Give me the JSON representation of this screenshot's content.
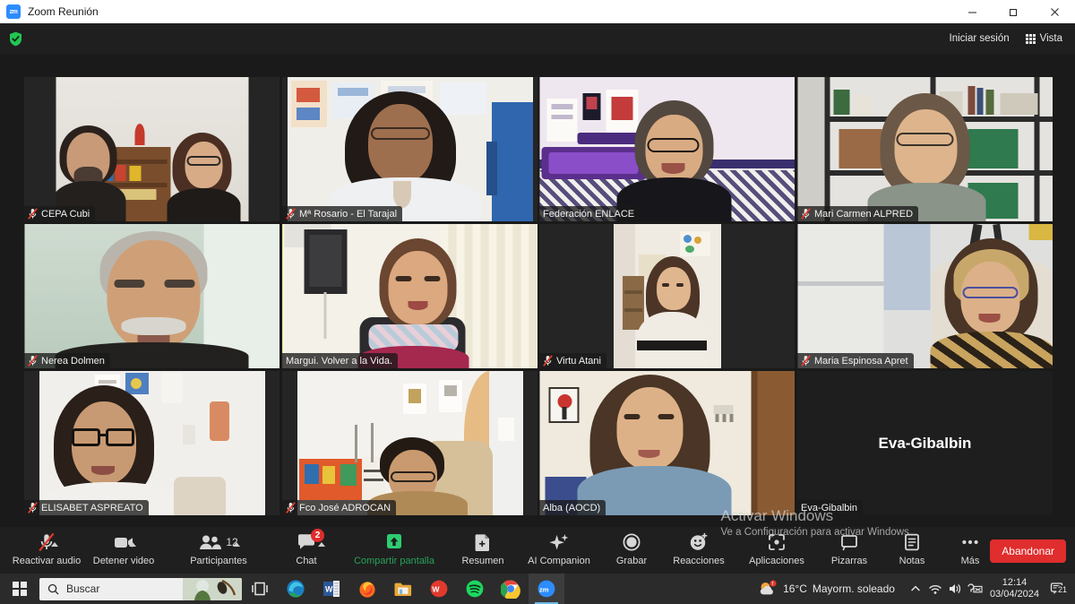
{
  "window": {
    "app_icon": "zoom-logo-icon",
    "title": "Zoom Reunión",
    "minimize": "–",
    "maximize": "□",
    "close": "✕"
  },
  "zoom_header": {
    "security_icon": "green-shield-check-icon",
    "sign_in_label": "Iniciar sesión",
    "view_label": "Vista",
    "view_icon": "grid-view-icon"
  },
  "participants_grid": {
    "rows": 3,
    "columns": 4,
    "tiles": [
      {
        "name": "CEPA Cubi",
        "muted": true,
        "camera_on": true,
        "active_speaker": false,
        "scene": "two-people-shelf"
      },
      {
        "name": "Mª Rosario - El Tarajal",
        "muted": true,
        "camera_on": true,
        "active_speaker": false,
        "scene": "woman-glasses-classroom"
      },
      {
        "name": "Federación ENLACE",
        "muted": false,
        "camera_on": true,
        "active_speaker": false,
        "scene": "woman-glasses-purple-wall"
      },
      {
        "name": "Mari Carmen ALPRED",
        "muted": true,
        "camera_on": true,
        "active_speaker": false,
        "scene": "woman-office-shelves"
      },
      {
        "name": "Nerea Dolmen",
        "muted": true,
        "camera_on": true,
        "active_speaker": false,
        "scene": "man-beard-green-wall"
      },
      {
        "name": "Margui. Volver a la Vida.",
        "muted": false,
        "camera_on": true,
        "active_speaker": true,
        "scene": "woman-scarf-speaker"
      },
      {
        "name": "Virtu Atani",
        "muted": true,
        "camera_on": true,
        "active_speaker": false,
        "scene": "woman-white-sweater-room"
      },
      {
        "name": "Maria Espinosa Apret",
        "muted": true,
        "camera_on": true,
        "active_speaker": false,
        "scene": "woman-leopard-print-office"
      },
      {
        "name": "ELISABET ASPREATO",
        "muted": true,
        "camera_on": true,
        "active_speaker": false,
        "scene": "woman-curly-hair-glasses"
      },
      {
        "name": "Fco José ADROCAN",
        "muted": true,
        "camera_on": true,
        "active_speaker": false,
        "scene": "man-desk-office"
      },
      {
        "name": "Alba (AOCD)",
        "muted": false,
        "camera_on": true,
        "active_speaker": false,
        "scene": "woman-blue-sweater-door"
      },
      {
        "name": "Eva-Gibalbin",
        "muted": false,
        "camera_on": false,
        "active_speaker": false,
        "display_name": "Eva-Gibalbin"
      }
    ]
  },
  "toolbar": {
    "items": [
      {
        "label": "Reactivar audio",
        "icon": "microphone-muted-icon",
        "has_caret": true
      },
      {
        "label": "Detener video",
        "icon": "video-camera-icon",
        "has_caret": true
      },
      {
        "label": "Participantes",
        "icon": "participants-icon",
        "has_caret": true,
        "count": "12"
      },
      {
        "label": "Chat",
        "icon": "chat-bubble-icon",
        "has_caret": true,
        "badge": "2"
      },
      {
        "label": "Compartir pantalla",
        "icon": "share-screen-up-arrow-icon",
        "highlight": "#25a35a"
      },
      {
        "label": "Resumen",
        "icon": "summary-document-icon"
      },
      {
        "label": "AI Companion",
        "icon": "ai-sparkles-icon"
      },
      {
        "label": "Grabar",
        "icon": "record-circle-icon"
      },
      {
        "label": "Reacciones",
        "icon": "reactions-smiley-icon"
      },
      {
        "label": "Aplicaciones",
        "icon": "apps-brackets-icon"
      },
      {
        "label": "Pizarras",
        "icon": "whiteboard-icon"
      },
      {
        "label": "Notas",
        "icon": "notes-icon"
      },
      {
        "label": "Más",
        "icon": "more-dots-icon"
      }
    ],
    "leave_label": "Abandonar"
  },
  "watermark": {
    "line1": "Activar Windows",
    "line2": "Ve a Configuración para activar Windows."
  },
  "taskbar": {
    "start_icon": "windows-start-icon",
    "search_placeholder": "Buscar",
    "search_icon": "search-magnifier-icon",
    "taskview_icon": "task-view-icon",
    "apps": [
      {
        "name": "edge-icon",
        "label": "Microsoft Edge",
        "active": false
      },
      {
        "name": "word-icon",
        "label": "Word",
        "active": false
      },
      {
        "name": "firefox-icon",
        "label": "Firefox",
        "active": false
      },
      {
        "name": "file-explorer-icon",
        "label": "Explorador de archivos",
        "active": false
      },
      {
        "name": "wps-office-icon",
        "label": "WPS Office",
        "active": false
      },
      {
        "name": "spotify-icon",
        "label": "Spotify",
        "active": false
      },
      {
        "name": "chrome-icon",
        "label": "Google Chrome",
        "active": false
      },
      {
        "name": "zoom-taskbar-icon",
        "label": "Zoom",
        "active": true
      }
    ],
    "tray": {
      "weather_temp": "16°C",
      "weather_desc": "Mayorm. soleado",
      "chevron_icon": "show-hidden-icons-chevron",
      "network_icon": "wifi-icon",
      "volume_icon": "speaker-icon",
      "keyboard_icon": "input-indicator-icon",
      "time": "12:14",
      "date": "03/04/2024",
      "notification_icon": "notifications-icon",
      "notification_count": "21"
    }
  }
}
